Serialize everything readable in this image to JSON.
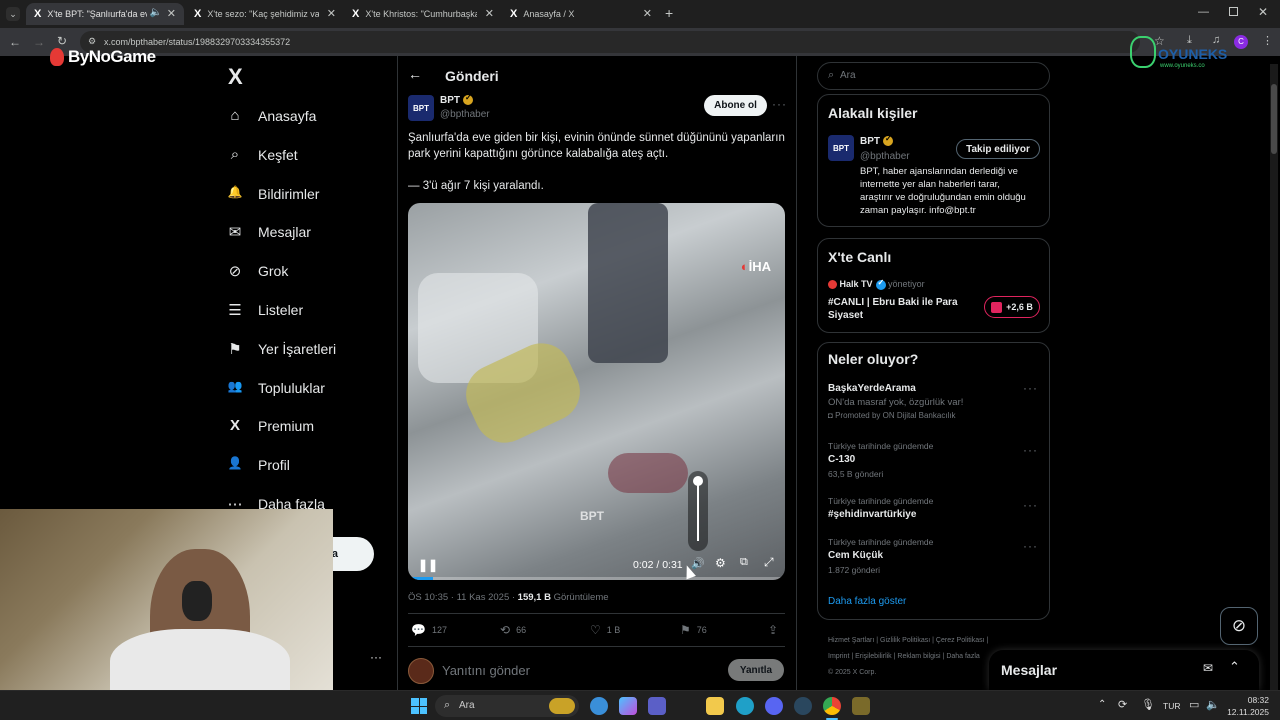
{
  "browser": {
    "tabs": [
      {
        "title": "X'te BPT: \"Şanlıurfa'da eve g",
        "active": true
      },
      {
        "title": "X'te sezo: \"Kaç şehidimiz var Al",
        "active": false
      },
      {
        "title": "X'te Khristos: \"Cumhurbaşkanı",
        "active": false
      },
      {
        "title": "Anasayfa / X",
        "active": false
      }
    ],
    "new_tab": "+",
    "url": "x.com/bpthaber/status/1988329703334355372"
  },
  "overlays": {
    "bynogame": "ByNoGame",
    "oyuneks": "OYUNEKS",
    "oyuneks_url": "www.oyuneks.co"
  },
  "nav": {
    "logo": "X",
    "items": [
      {
        "label": "Anasayfa",
        "icon": "home-icon",
        "glyph": "⌂"
      },
      {
        "label": "Keşfet",
        "icon": "search-icon",
        "glyph": "⌕"
      },
      {
        "label": "Bildirimler",
        "icon": "bell-icon",
        "glyph": "🔔"
      },
      {
        "label": "Mesajlar",
        "icon": "mail-icon",
        "glyph": "✉"
      },
      {
        "label": "Grok",
        "icon": "grok-icon",
        "glyph": "⊘"
      },
      {
        "label": "Listeler",
        "icon": "list-icon",
        "glyph": "☰"
      },
      {
        "label": "Yer İşaretleri",
        "icon": "bookmark-icon",
        "glyph": "⚑"
      },
      {
        "label": "Topluluklar",
        "icon": "communities-icon",
        "glyph": "👥"
      },
      {
        "label": "Premium",
        "icon": "x-premium-icon",
        "glyph": "X"
      },
      {
        "label": "Profil",
        "icon": "profile-icon",
        "glyph": "👤"
      },
      {
        "label": "Daha fazla",
        "icon": "more-circle-icon",
        "glyph": "⋯"
      }
    ],
    "post_button_partial": "a",
    "more_dots": "···"
  },
  "main": {
    "header_title": "Gönderi",
    "author": {
      "name": "BPT",
      "handle": "@bpthaber",
      "avatar_text": "BPT"
    },
    "follow_button": "Abone ol",
    "text_line1": "Şanlıurfa'da eve giden bir kişi, evinin önünde sünnet düğününü yapanların",
    "text_line2": "park yerini kapattığını görünce kalabalığa ateş açtı.",
    "text_line3": "— 3'ü ağır 7 kişi yaralandı.",
    "video": {
      "watermark": "İHA",
      "center_watermark": "BPT",
      "time": "0:02 / 0:31",
      "progress": 0.065,
      "volume": 1.0
    },
    "meta_time": "ÖS 10:35 · 11 Kas 2025 · ",
    "meta_views": "159,1 B",
    "meta_views_label": " Görüntüleme",
    "actions": {
      "replies": "127",
      "reposts": "66",
      "likes": "1 B",
      "bookmarks": "76"
    },
    "reply_placeholder": "Yanıtını gönder",
    "reply_button": "Yanıtla"
  },
  "right": {
    "search_placeholder": "Ara",
    "relevant": {
      "title": "Alakalı kişiler",
      "name": "BPT",
      "handle": "@bpthaber",
      "button": "Takip ediliyor",
      "bio": [
        "BPT, haber ajanslarından derlediği ve",
        "internette yer alan haberleri tarar,",
        "araştırır ve doğruluğundan emin olduğu",
        "zaman paylaşır. info@bpt.tr"
      ]
    },
    "live": {
      "title": "X'te Canlı",
      "host": "Halk TV",
      "host_suffix": "yönetiyor",
      "line1": "#CANLI | Ebru Baki ile Para",
      "line2": "Siyaset",
      "count": "+2,6 B"
    },
    "trends": {
      "title": "Neler oluyor?",
      "items": [
        {
          "top": "",
          "name": "BaşkaYerdeArama",
          "sub": "ON'da masraf yok, özgürlük var!",
          "extra": "Promoted by ON Dijital Bankacılık"
        },
        {
          "top": "Türkiye tarihinde gündemde",
          "name": "C-130",
          "sub": "63,5 B gönderi",
          "extra": ""
        },
        {
          "top": "Türkiye tarihinde gündemde",
          "name": "#şehidinvartürkiye",
          "sub": "",
          "extra": ""
        },
        {
          "top": "Türkiye tarihinde gündemde",
          "name": "Cem Küçük",
          "sub": "1.872 gönderi",
          "extra": ""
        }
      ],
      "show_more": "Daha fazla göster"
    },
    "footer": {
      "l1a": "Hizmet Şartları",
      "l1b": "Gizlilik Politikası",
      "l1c": "Çerez Politikası",
      "l2a": "Imprint",
      "l2b": "Erişilebilirlik",
      "l2c": "Reklam bilgisi",
      "l2d": "Daha fazla",
      "copy": "© 2025 X Corp."
    },
    "messages_drawer": "Mesajlar"
  },
  "taskbar": {
    "search": "Ara",
    "lang": "TUR",
    "time": "08:32",
    "date": "12.11.2025"
  },
  "colors": {
    "accent": "#1d9bf0",
    "bg": "#000000",
    "border": "#2f3336",
    "muted": "#71767b"
  }
}
